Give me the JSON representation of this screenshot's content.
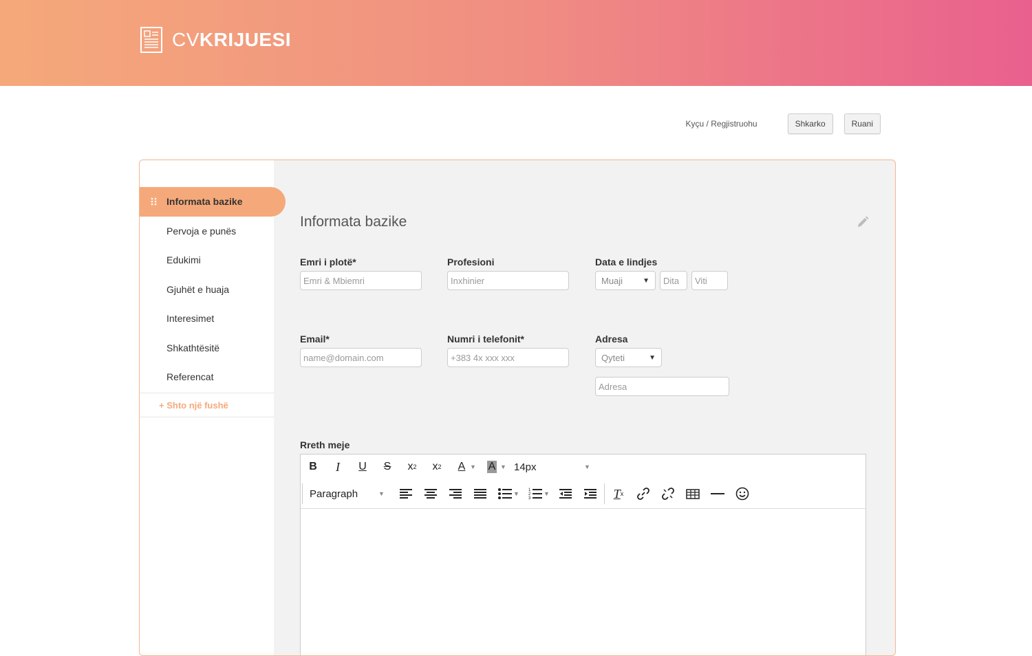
{
  "header": {
    "brand_prefix": "CV",
    "brand_name": "KRIJUESI"
  },
  "topnav": {
    "login": "Kyçu / Regjistruohu",
    "download": "Shkarko",
    "save": "Ruani"
  },
  "sidebar": {
    "items": [
      {
        "label": "Informata bazike"
      },
      {
        "label": "Pervoja e punës"
      },
      {
        "label": "Edukimi"
      },
      {
        "label": "Gjuhët e huaja"
      },
      {
        "label": "Interesimet"
      },
      {
        "label": "Shkathtësitë"
      },
      {
        "label": "Referencat"
      }
    ],
    "add_field": "+ Shto një fushë"
  },
  "form": {
    "title": "Informata bazike",
    "full_name": {
      "label": "Emri i plotë*",
      "placeholder": "Emri & Mbiemri"
    },
    "profession": {
      "label": "Profesioni",
      "placeholder": "Inxhinier"
    },
    "birth_date": {
      "label": "Data e lindjes",
      "month": "Muaji",
      "day": "Dita",
      "year": "Viti"
    },
    "email": {
      "label": "Email*",
      "placeholder": "name@domain.com"
    },
    "phone": {
      "label": "Numri i telefonit*",
      "placeholder": "+383 4x xxx xxx"
    },
    "address": {
      "label": "Adresa",
      "city": "Qyteti",
      "placeholder": "Adresa"
    },
    "about": {
      "label": "Rreth meje",
      "font_size": "14px",
      "block_format": "Paragraph"
    }
  },
  "colors": {
    "accent": "#f5a97a",
    "gradient_end": "#e9608e"
  }
}
